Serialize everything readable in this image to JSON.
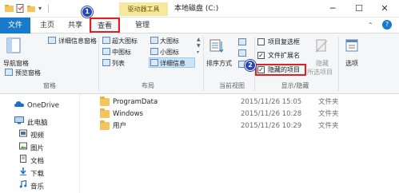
{
  "window": {
    "title": "本地磁盘 (C:)",
    "context_tab": "驱动器工具",
    "minimize": "─",
    "maximize": "☐",
    "close": "✕"
  },
  "tabs": [
    "文件",
    "主页",
    "共享",
    "查看",
    "管理"
  ],
  "annotations": {
    "step1": "1",
    "step2": "2"
  },
  "ribbon": {
    "pane_group": {
      "label": "窗格",
      "nav_pane": "导航窗格",
      "preview_pane": "预览窗格",
      "details_pane": "详细信息窗格"
    },
    "layout_group": {
      "label": "布局",
      "items": [
        "超大图标",
        "大图标",
        "中图标",
        "小图标",
        "列表",
        "详细信息"
      ]
    },
    "current_view_group": {
      "label": "当前视图",
      "sort_by": "排序方式"
    },
    "show_hide_group": {
      "label": "显示/隐藏",
      "item_checkboxes": {
        "label": "项目复选框",
        "checked": false
      },
      "file_extensions": {
        "label": "文件扩展名",
        "checked": true
      },
      "hidden_items": {
        "label": "隐藏的项目",
        "checked": true
      },
      "hide_selected": "隐藏",
      "hide_selected_sub": "所选项目"
    },
    "options": "选项"
  },
  "nav": [
    {
      "label": "OneDrive",
      "icon": "cloud-icon"
    },
    {
      "label": "此电脑",
      "icon": "computer-icon"
    },
    {
      "label": "视频",
      "icon": "video-icon"
    },
    {
      "label": "图片",
      "icon": "picture-icon"
    },
    {
      "label": "文档",
      "icon": "document-icon"
    },
    {
      "label": "下载",
      "icon": "download-icon"
    },
    {
      "label": "音乐",
      "icon": "music-icon"
    }
  ],
  "files": [
    {
      "name": "ProgramData",
      "date": "2015/11/26 15:05",
      "type": "文件夹"
    },
    {
      "name": "Windows",
      "date": "2015/11/26 10:28",
      "type": "文件夹"
    },
    {
      "name": "用户",
      "date": "2015/11/26 10:29",
      "type": "文件夹"
    }
  ],
  "colors": {
    "file_tab": "#1979ca",
    "context_tab_bg": "#f6e89d",
    "annotation_box": "#e02020",
    "annotation_badge": "#2a46b8",
    "folder": "#f4c55a"
  }
}
